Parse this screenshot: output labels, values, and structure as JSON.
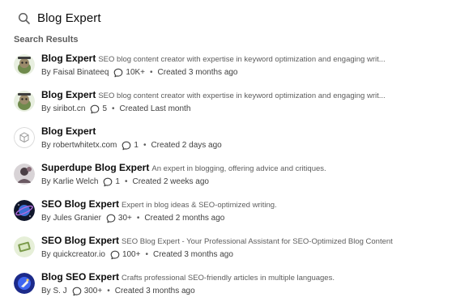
{
  "search": {
    "query": "Blog Expert"
  },
  "section_label": "Search Results",
  "bullet": "•",
  "results": [
    {
      "title": "Blog Expert",
      "description": "SEO blog content creator with expertise in keyword optimization and engaging writ...",
      "author": "By Faisal Binateeq",
      "count": "10K+",
      "created": "Created 3 months ago",
      "avatar": "badger"
    },
    {
      "title": "Blog Expert",
      "description": "SEO blog content creator with expertise in keyword optimization and engaging writ...",
      "author": "By siribot.cn",
      "count": "5",
      "created": "Created Last month",
      "avatar": "badger"
    },
    {
      "title": "Blog Expert",
      "description": "",
      "author": "By robertwhitetx.com",
      "count": "1",
      "created": "Created 2 days ago",
      "avatar": "cube"
    },
    {
      "title": "Superdupe Blog Expert",
      "description": "An expert in blogging, offering advice and critiques.",
      "author": "By Karlie Welch",
      "count": "1",
      "created": "Created 2 weeks ago",
      "avatar": "sketch"
    },
    {
      "title": "SEO Blog Expert",
      "description": "Expert in blog ideas & SEO-optimized writing.",
      "author": "By Jules Granier",
      "count": "30+",
      "created": "Created 2 months ago",
      "avatar": "planet"
    },
    {
      "title": "SEO Blog Expert",
      "description": "SEO Blog Expert - Your Professional Assistant for SEO-Optimized Blog Content",
      "author": "By quickcreator.io",
      "count": "100+",
      "created": "Created 3 months ago",
      "avatar": "device"
    },
    {
      "title": "Blog SEO Expert",
      "description": "Crafts professional SEO-friendly articles in multiple languages.",
      "author": "By S. J",
      "count": "300+",
      "created": "Created 3 months ago",
      "avatar": "orb"
    }
  ]
}
